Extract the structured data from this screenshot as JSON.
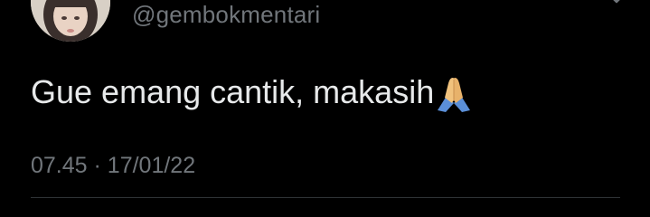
{
  "tweet": {
    "handle": "@gembokmentari",
    "text": "Gue emang cantik, makasih",
    "emoji": "folded-hands",
    "time": "07.45",
    "separator": "·",
    "date": "17/01/22"
  },
  "colors": {
    "background": "#000000",
    "primary_text": "#e7e9ea",
    "secondary_text": "#71767b",
    "divider": "#2f3336"
  }
}
